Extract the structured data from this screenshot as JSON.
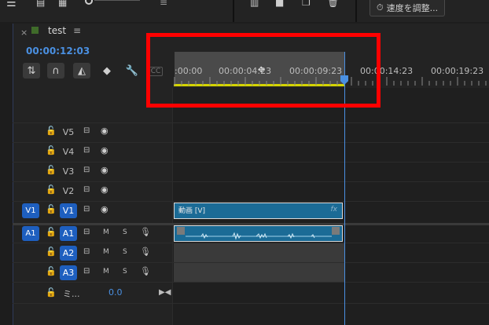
{
  "toolbar": {
    "speed_button": "速度を調整..."
  },
  "sequence": {
    "tab_title": "test",
    "close_glyph": "×",
    "menu_glyph": "≡",
    "timecode": "00:00:12:03"
  },
  "ruler": {
    "labels": [
      ":00:00",
      "00:00:04:23",
      "00:00:09:23",
      "00:00:14:23",
      "00:00:19:23"
    ],
    "playhead_position_timecode": "00:00:12:03"
  },
  "tracks": {
    "video": [
      {
        "name": "V5",
        "targeted": false
      },
      {
        "name": "V4",
        "targeted": false
      },
      {
        "name": "V3",
        "targeted": false
      },
      {
        "name": "V2",
        "targeted": false
      },
      {
        "name": "V1",
        "targeted": true,
        "source": "V1"
      }
    ],
    "audio": [
      {
        "name": "A1",
        "targeted": true,
        "source": "A1",
        "mute": "M",
        "solo": "S"
      },
      {
        "name": "A2",
        "targeted": true,
        "mute": "M",
        "solo": "S"
      },
      {
        "name": "A3",
        "targeted": true,
        "mute": "M",
        "solo": "S"
      }
    ],
    "mix": {
      "label": "ミ...",
      "value": "0.0"
    }
  },
  "clips": {
    "video_label": "動画 [V]",
    "video_fx": "fx"
  },
  "colors": {
    "accent_blue": "#4a90e2",
    "clip_blue": "#1b6b96",
    "work_area_yellow": "#d4d400",
    "highlight_red": "#ff0000"
  },
  "icons": [
    "snap-icon",
    "linked-selection-icon",
    "add-marker-icon",
    "settings-wrench-icon",
    "captions-icon",
    "lock-icon",
    "sync-lock-icon",
    "eye-icon",
    "mic-icon"
  ]
}
